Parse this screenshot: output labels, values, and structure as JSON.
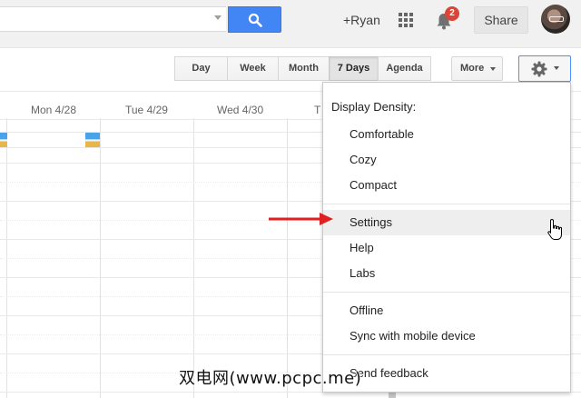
{
  "search": {
    "value": "",
    "placeholder": ""
  },
  "account": {
    "user_label": "+Ryan",
    "notification_count": "2",
    "share_label": "Share"
  },
  "views": {
    "items": [
      {
        "label": "Day",
        "active": false
      },
      {
        "label": "Week",
        "active": false
      },
      {
        "label": "Month",
        "active": false
      },
      {
        "label": "7 Days",
        "active": true
      },
      {
        "label": "Agenda",
        "active": false
      }
    ],
    "more_label": "More"
  },
  "calendar": {
    "day_headers": [
      "Mon 4/28",
      "Tue 4/29",
      "Wed 4/30",
      "T"
    ]
  },
  "settings_menu": {
    "heading": "Display Density:",
    "density_items": [
      "Comfortable",
      "Cozy",
      "Compact"
    ],
    "main_items": [
      "Settings",
      "Help",
      "Labs"
    ],
    "highlighted_item": "Settings",
    "extra_items": [
      "Offline",
      "Sync with mobile device"
    ],
    "feedback_item": "Send feedback"
  },
  "watermark": {
    "text": "双电网(www.pcpc.me)"
  },
  "colors": {
    "search_button": "#4285f4",
    "notification_badge": "#db4437",
    "annotation_arrow": "#e02020",
    "focus_border": "#4d90fe"
  }
}
